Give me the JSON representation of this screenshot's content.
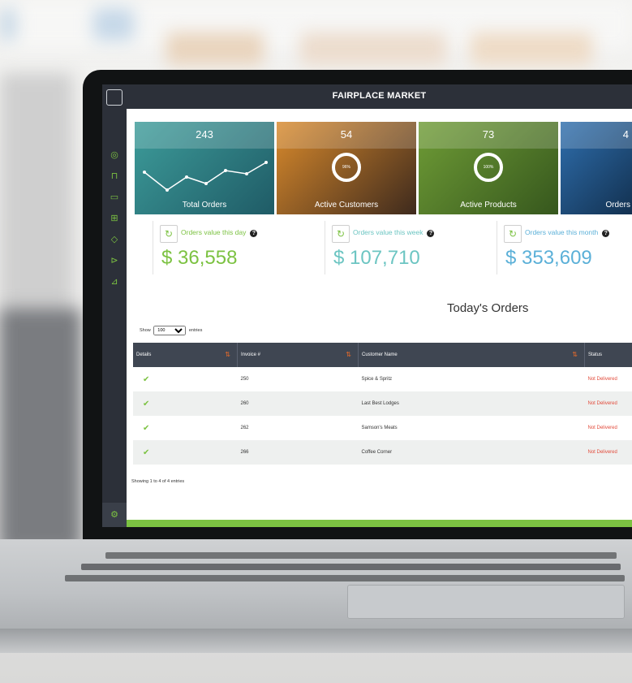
{
  "app": {
    "title": "FAIRPLACE MARKET"
  },
  "cards": [
    {
      "value": "243",
      "label": "Total Orders",
      "color": "#2f8a8c"
    },
    {
      "value": "54",
      "label": "Active Customers",
      "color": "#c46b1e",
      "ring": "96%"
    },
    {
      "value": "73",
      "label": "Active Products",
      "color": "#5a8a2a",
      "ring": "100%"
    },
    {
      "value": "4",
      "label": "Orders",
      "color": "#1f5f9a"
    }
  ],
  "stats": [
    {
      "label": "Orders value this day",
      "value": "$ 36,558",
      "label_color": "#7cc242",
      "value_color": "#7cc242"
    },
    {
      "label": "Orders value this week",
      "value": "$ 107,710",
      "label_color": "#6cc5c2",
      "value_color": "#6cc5c2"
    },
    {
      "label": "Orders value this month",
      "value": "$ 353,609",
      "label_color": "#5bb0d8",
      "value_color": "#5bb0d8"
    }
  ],
  "orders": {
    "title": "Today's Orders",
    "show_prefix": "Show",
    "show_value": "100",
    "show_suffix": "entries",
    "columns": [
      "Details",
      "Invoice #",
      "Customer Name",
      "Status"
    ],
    "rows": [
      {
        "invoice": "250",
        "customer": "Spice & Spritz",
        "status": "Not Delivered"
      },
      {
        "invoice": "260",
        "customer": "Last Best Lodges",
        "status": "Not Delivered"
      },
      {
        "invoice": "262",
        "customer": "Samson's Meats",
        "status": "Not Delivered"
      },
      {
        "invoice": "266",
        "customer": "Coffee Corner",
        "status": "Not Delivered"
      }
    ],
    "footer": "Showing 1 to 4 of 4 entries"
  },
  "sidebar": {
    "icons": [
      "user-circle-icon",
      "cart-icon",
      "folder-icon",
      "cubes-icon",
      "tag-icon",
      "truck-icon",
      "chart-icon"
    ],
    "bottom_icon": "settings-icon"
  }
}
